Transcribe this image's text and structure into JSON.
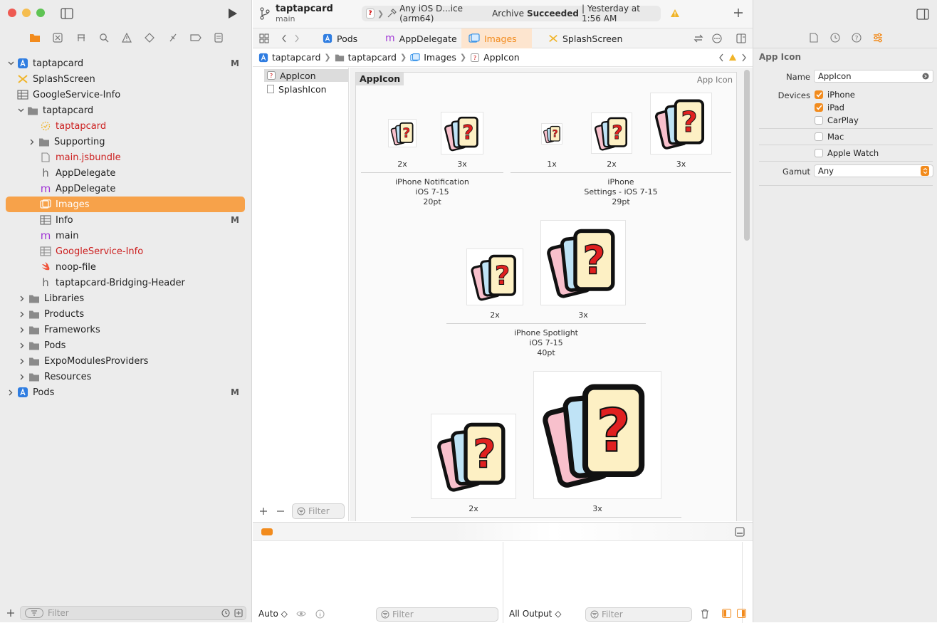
{
  "project": {
    "name": "taptapcard",
    "branch": "main"
  },
  "status": {
    "scheme": "Any iOS D...ice (arm64)",
    "action": "Archive",
    "result": "Succeeded",
    "time": "| Yesterday at 1:56 AM"
  },
  "tabs": [
    {
      "label": "Pods"
    },
    {
      "label": "AppDelegate"
    },
    {
      "label": "Images"
    },
    {
      "label": "SplashScreen"
    }
  ],
  "breadcrumb": [
    "taptapcard",
    "taptapcard",
    "Images",
    "AppIcon"
  ],
  "navigator": {
    "items": [
      {
        "label": "taptapcard",
        "mark": "M"
      },
      {
        "label": "SplashScreen"
      },
      {
        "label": "GoogleService-Info"
      },
      {
        "label": "taptapcard"
      },
      {
        "label": "taptapcard"
      },
      {
        "label": "Supporting"
      },
      {
        "label": "main.jsbundle"
      },
      {
        "label": "AppDelegate"
      },
      {
        "label": "AppDelegate"
      },
      {
        "label": "Images"
      },
      {
        "label": "Info",
        "mark": "M"
      },
      {
        "label": "main"
      },
      {
        "label": "GoogleService-Info"
      },
      {
        "label": "noop-file"
      },
      {
        "label": "taptapcard-Bridging-Header"
      },
      {
        "label": "Libraries"
      },
      {
        "label": "Products"
      },
      {
        "label": "Frameworks"
      },
      {
        "label": "Pods"
      },
      {
        "label": "ExpoModulesProviders"
      },
      {
        "label": "Resources"
      },
      {
        "label": "Pods",
        "mark": "M"
      }
    ],
    "filter_placeholder": "Filter"
  },
  "assets": {
    "items": [
      {
        "label": "AppIcon"
      },
      {
        "label": "SplashIcon"
      }
    ],
    "filter_placeholder": "Filter"
  },
  "icon_set": {
    "title": "AppIcon",
    "kind": "App Icon",
    "scales": {
      "s1x": "1x",
      "s2x": "2x",
      "s3x": "3x"
    },
    "groups": [
      {
        "line1": "iPhone Notification",
        "line2": "iOS 7-15",
        "line3": "20pt"
      },
      {
        "line1": "iPhone",
        "line2": "Settings - iOS 7-15",
        "line3": "29pt"
      },
      {
        "line1": "iPhone Spotlight",
        "line2": "iOS 7-15",
        "line3": "40pt"
      }
    ]
  },
  "debug": {
    "auto_label": "Auto ◇",
    "output_label": "All Output ◇",
    "filter_placeholder": "Filter"
  },
  "inspector": {
    "section_title": "App Icon",
    "name_label": "Name",
    "name_value": "AppIcon",
    "devices_label": "Devices",
    "devices": [
      {
        "label": "iPhone",
        "checked": true
      },
      {
        "label": "iPad",
        "checked": true
      },
      {
        "label": "CarPlay",
        "checked": false
      },
      {
        "label": "Mac",
        "checked": false
      },
      {
        "label": "Apple Watch",
        "checked": false
      }
    ],
    "gamut_label": "Gamut",
    "gamut_value": "Any"
  },
  "colors": {
    "accent": "#f28b1d",
    "selection": "#f7a24a",
    "error_text": "#cc1f1f"
  }
}
